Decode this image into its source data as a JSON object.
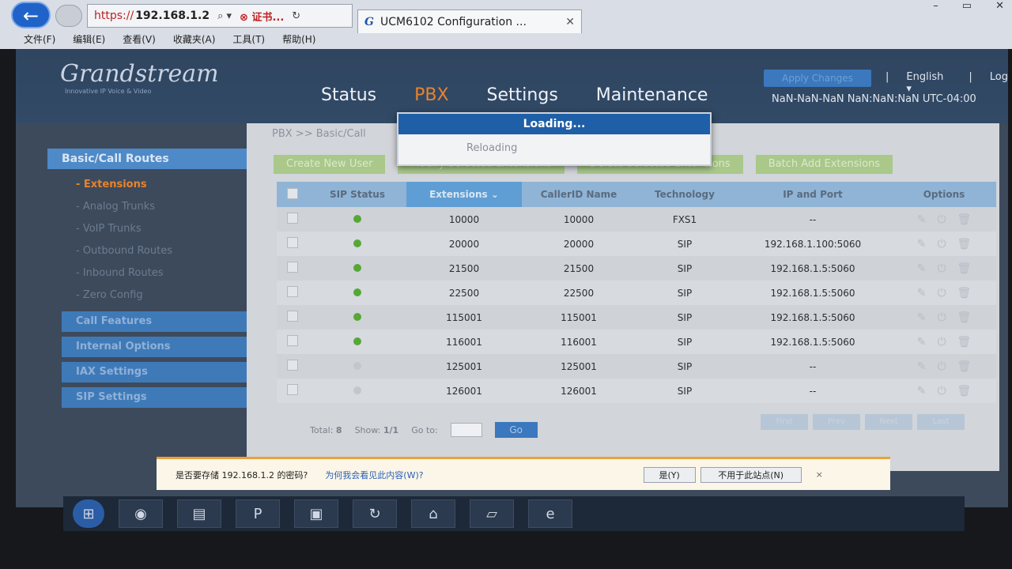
{
  "browser": {
    "back_icon": "←",
    "address": {
      "scheme": "https://",
      "host": "192.168.1.2",
      "cert_label": "证书..."
    },
    "tab_title": "UCM6102 Configuration ...",
    "tab_logo": "G",
    "menu": [
      "文件(F)",
      "编辑(E)",
      "查看(V)",
      "收藏夹(A)",
      "工具(T)",
      "帮助(H)"
    ]
  },
  "header": {
    "logo_text": "Grandstream",
    "logo_tagline": "Innovative IP Voice & Video",
    "nav": [
      {
        "label": "Status",
        "active": false
      },
      {
        "label": "PBX",
        "active": true
      },
      {
        "label": "Settings",
        "active": false
      },
      {
        "label": "Maintenance",
        "active": false
      }
    ],
    "apply_label": "Apply Changes",
    "separator": "|",
    "language": "English ▾",
    "logout_label": "Log",
    "clock": "NaN-NaN-NaN NaN:NaN:NaN UTC-04:00"
  },
  "sidebar": {
    "section_title": "Basic/Call Routes",
    "sub_items": [
      {
        "label": "- Extensions",
        "active": true
      },
      {
        "label": "- Analog Trunks",
        "active": false
      },
      {
        "label": "- VoIP Trunks",
        "active": false
      },
      {
        "label": "- Outbound Routes",
        "active": false
      },
      {
        "label": "- Inbound Routes",
        "active": false
      },
      {
        "label": "- Zero Config",
        "active": false
      }
    ],
    "items": [
      "Call Features",
      "Internal Options",
      "IAX Settings",
      "SIP Settings"
    ]
  },
  "content": {
    "breadcrumb": "PBX >> Basic/Call",
    "toolbar": [
      "Create New User",
      "Modify Selected Extensions",
      "Delete Selected Extensions",
      "Batch Add Extensions"
    ],
    "columns": [
      "SIP Status",
      "Extensions ⌄",
      "CallerID Name",
      "Technology",
      "IP and Port",
      "Options"
    ],
    "rows": [
      {
        "online": true,
        "ext": "10000",
        "caller": "10000",
        "tech": "FXS1",
        "ip": "--"
      },
      {
        "online": true,
        "ext": "20000",
        "caller": "20000",
        "tech": "SIP",
        "ip": "192.168.1.100:5060"
      },
      {
        "online": true,
        "ext": "21500",
        "caller": "21500",
        "tech": "SIP",
        "ip": "192.168.1.5:5060"
      },
      {
        "online": true,
        "ext": "22500",
        "caller": "22500",
        "tech": "SIP",
        "ip": "192.168.1.5:5060"
      },
      {
        "online": true,
        "ext": "115001",
        "caller": "115001",
        "tech": "SIP",
        "ip": "192.168.1.5:5060"
      },
      {
        "online": true,
        "ext": "116001",
        "caller": "116001",
        "tech": "SIP",
        "ip": "192.168.1.5:5060"
      },
      {
        "online": false,
        "ext": "125001",
        "caller": "125001",
        "tech": "SIP",
        "ip": "--"
      },
      {
        "online": false,
        "ext": "126001",
        "caller": "126001",
        "tech": "SIP",
        "ip": "--"
      }
    ],
    "footer": {
      "total_label": "Total:",
      "total": "8",
      "show_label": "Show:",
      "show": "1/1",
      "goto_label": "Go to:",
      "go_label": "Go"
    },
    "pager": [
      "First",
      "Prev",
      "Next",
      "Last"
    ],
    "option_icons": [
      "edit-icon",
      "reboot-icon",
      "delete-icon"
    ]
  },
  "dialog": {
    "title": "Loading...",
    "message": "Reloading"
  },
  "password_bar": {
    "question": "是否要存储 192.168.1.2 的密码?",
    "why_link": "为何我会看见此内容(W)?",
    "yes": "是(Y)",
    "no": "不用于此站点(N)",
    "close": "×"
  },
  "taskbar": [
    "start-icon",
    "chrome-icon",
    "explorer-icon",
    "powerpoint-icon",
    "screenshot-icon",
    "sync-icon",
    "network-icon",
    "folder-icon",
    "ie-icon"
  ]
}
